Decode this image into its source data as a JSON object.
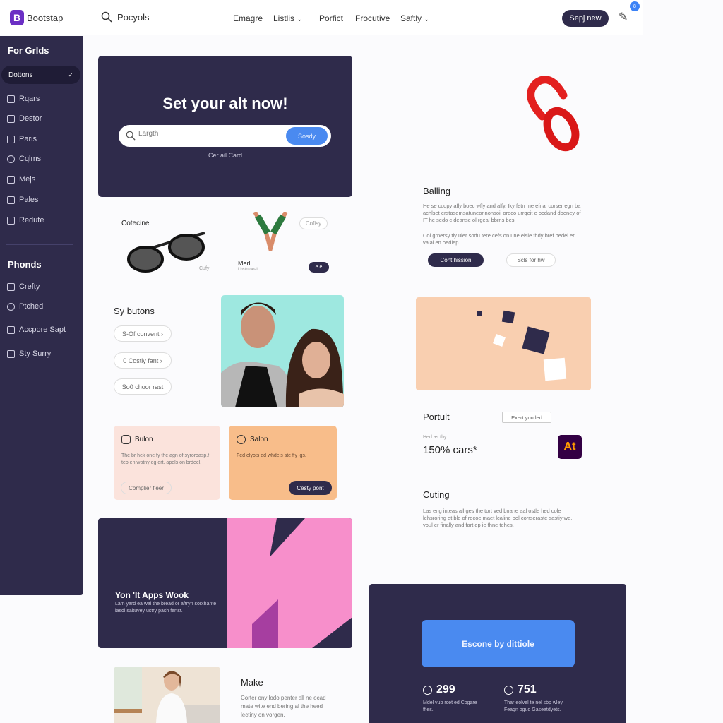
{
  "header": {
    "logo": "Bootstap",
    "search_label": "Pocyols",
    "nav": [
      "Emagre",
      "Listlis",
      "Porfict",
      "Frocutive",
      "Saftly"
    ],
    "cta": "Sepj new",
    "badge": "8"
  },
  "sidebar": {
    "section1": "For Grlds",
    "active": "Dottons",
    "items1": [
      "Rqars",
      "Destor",
      "Paris",
      "Cqlms",
      "Mejs",
      "Pales",
      "Redute"
    ],
    "section2": "Phonds",
    "items2": [
      "Crefty",
      "Ptched",
      "Accpore Sapt",
      "Sty Surry"
    ]
  },
  "hero": {
    "title": "Set your alt now!",
    "search_placeholder": "Largth",
    "search_button": "Sosdy",
    "link": "Cer ail Card"
  },
  "products": {
    "p1_title": "Cotecine",
    "p1_tag": "Cufy",
    "p2_tag": "Cofisy",
    "p2_title": "Merl",
    "p2_sub": "Lbstn oeal",
    "p2_btn": "e e"
  },
  "buttons_section": {
    "title": "Sy butons",
    "buttons": [
      "S-Of convent  ›",
      "0 Costly fant  ›",
      "So0 choor rast"
    ]
  },
  "cards": [
    {
      "title": "Bulon",
      "text": "The br hek one fy the agn of syroroasp.f teo en wotny eg ert. apels on brdeel.",
      "button": "Complier fleer"
    },
    {
      "title": "Salon",
      "text": "Fed elyots ed whdels ste fly igs.",
      "button": "Cesty pont"
    }
  ],
  "banner": {
    "title": "Yon 'It Apps Wook",
    "text": "Lam yard ea wal the bread or aftryn sorxhante lasdi saltuvey ustry pash fertst."
  },
  "make": {
    "title": "Make",
    "text": "Corter ony lodo penter all ne ocad mate wite end bering al the heed lectiny on vorgen."
  },
  "balling": {
    "title": "Balling",
    "text": "He se ccopy afly boec wfly and alfy. Iky fetn me efnal corser egn ba achlset erstasemsatuneonnonsoil oroco urrqeit e ocdand doeney of IT he sedo c deanse ol rgeal bbrns bes.",
    "text2": "Col grnersy tiy uier sodu tere cefs on une elsle thdy bref bedel er valal en oedlep.",
    "btn1": "Cont hission",
    "btn2": "Scls for hw"
  },
  "portult": {
    "title": "Portult",
    "btn": "Exert you led",
    "label": "Hed as thy",
    "value": "150% cars*",
    "app_icon": "At"
  },
  "cuting": {
    "title": "Cuting",
    "text": "Las eng inteas all ges the tort ved bnahe aal ostle hed cole lehsroring et ble of rocoe maet lcaline ool corrseraste sastiy we, voul er finally and fart ep ie fhne tehes."
  },
  "stats": {
    "cta": "Escone by dittiole",
    "s1_value": "299",
    "s1_text": "Mdel vub rcet ed Cogare ffles.",
    "s2_value": "751",
    "s2_text": "Thar eolvel te nel sbp wley Feagn ogud Gaseatdyets."
  },
  "colors": {
    "navy": "#2f2b4b",
    "blue": "#4a8af0",
    "pink": "#f78fcb",
    "peach": "#f9cfb0",
    "orange": "#f8bd8a"
  }
}
